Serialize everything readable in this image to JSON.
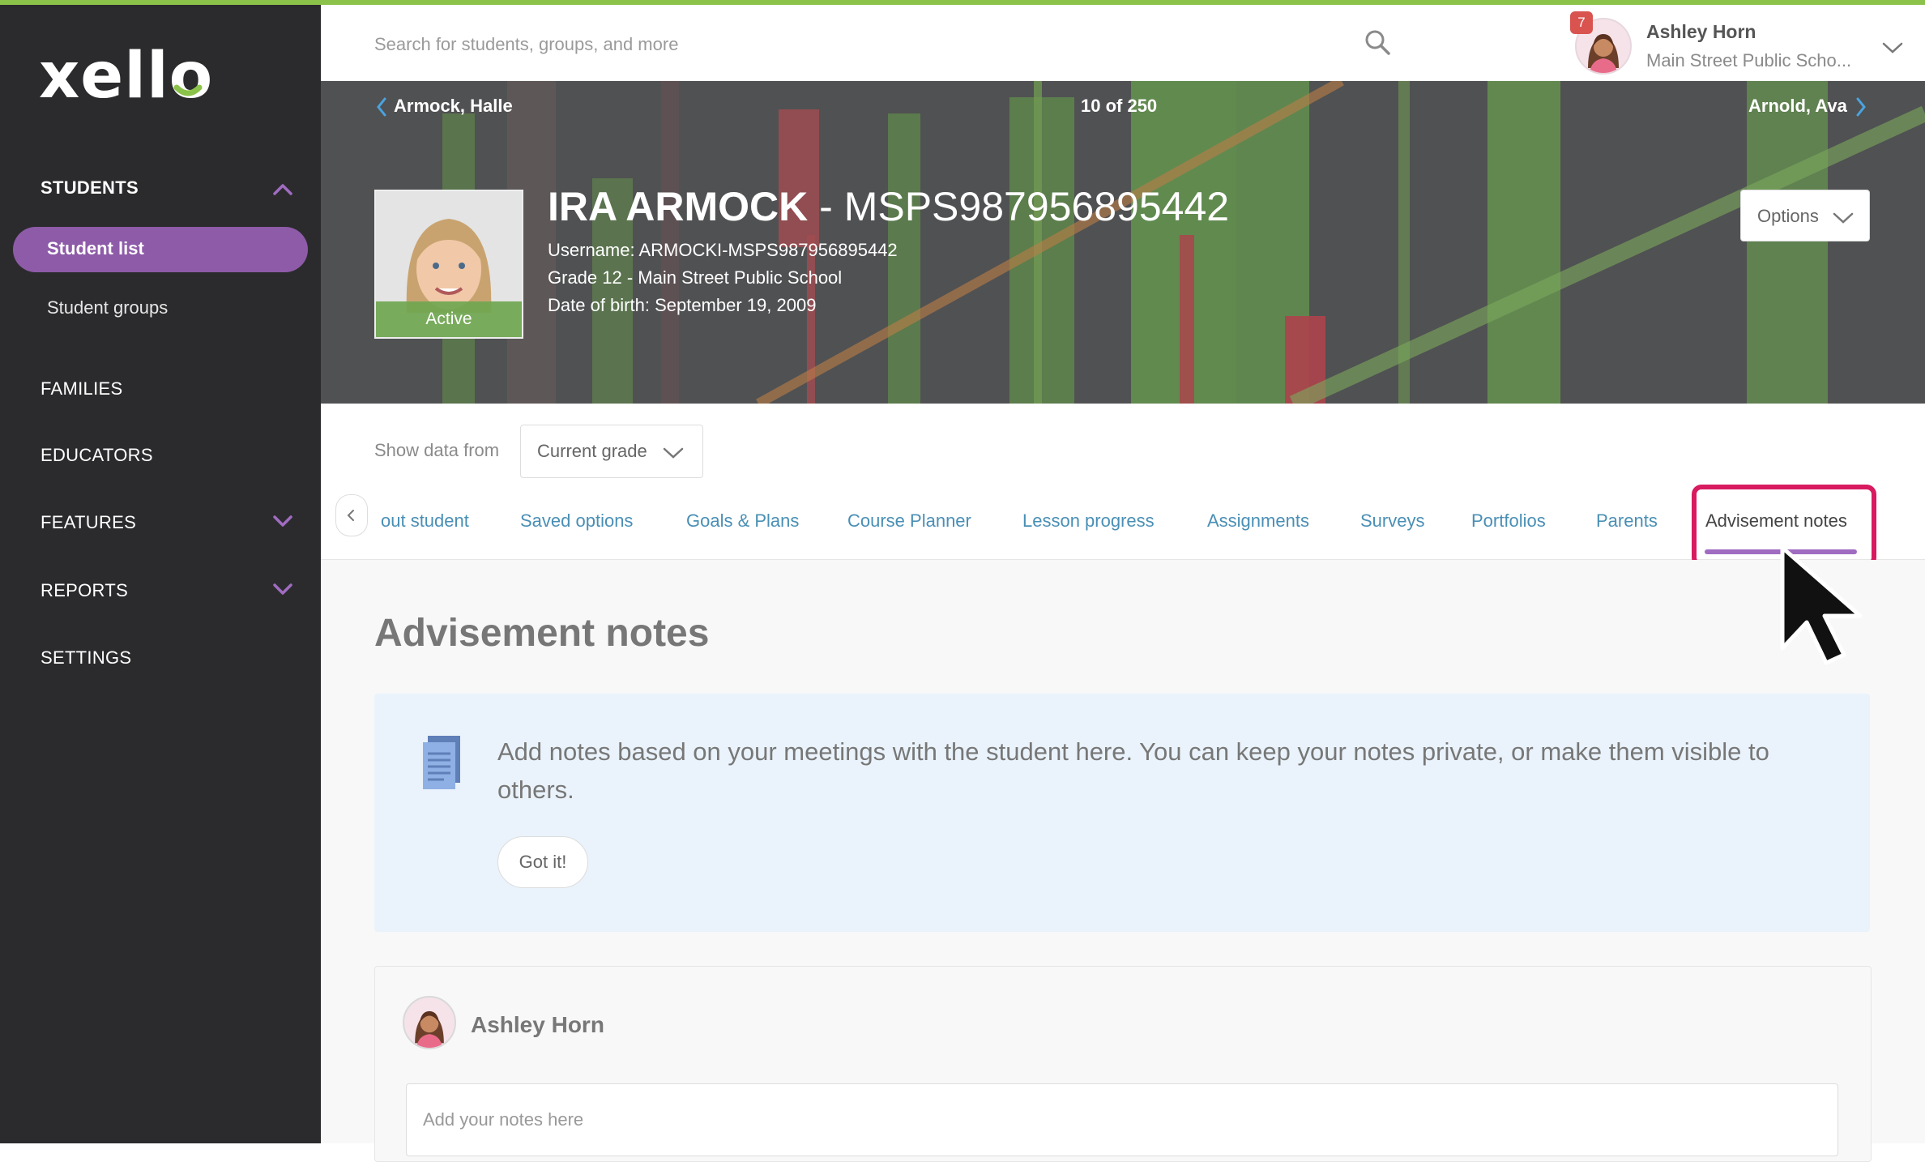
{
  "app": {
    "logo_text": "xello",
    "accent_color": "#8e5ba8",
    "top_border_color": "#8bc34a"
  },
  "sidebar": {
    "sections": [
      {
        "label": "STUDENTS",
        "expanded": true,
        "icon": "chevron-up-icon"
      },
      {
        "label": "FAMILIES"
      },
      {
        "label": "EDUCATORS"
      },
      {
        "label": "FEATURES",
        "icon": "chevron-down-icon"
      },
      {
        "label": "REPORTS",
        "icon": "chevron-down-icon"
      },
      {
        "label": "SETTINGS"
      }
    ],
    "student_items": [
      {
        "label": "Student list",
        "active": true
      },
      {
        "label": "Student groups"
      }
    ]
  },
  "topbar": {
    "search_placeholder": "Search for students, groups, and more",
    "notification_count": "7",
    "user_name": "Ashley Horn",
    "user_school": "Main Street Public Scho..."
  },
  "banner": {
    "prev_student": "Armock, Halle",
    "position": "10 of 250",
    "next_student": "Arnold, Ava",
    "student_name": "IRA ARMOCK",
    "student_separator": " - ",
    "student_id": "MSPS987956895442",
    "username_line": "Username: ARMOCKI-MSPS987956895442",
    "grade_line": "Grade 12 - Main Street Public School",
    "dob_line": "Date of birth: September 19, 2009",
    "status": "Active",
    "options_label": "Options"
  },
  "filter": {
    "label": "Show data from",
    "value": "Current grade"
  },
  "tabs": [
    {
      "label": "out student"
    },
    {
      "label": "Saved options"
    },
    {
      "label": "Goals & Plans"
    },
    {
      "label": "Course Planner"
    },
    {
      "label": "Lesson progress"
    },
    {
      "label": "Assignments"
    },
    {
      "label": "Surveys"
    },
    {
      "label": "Portfolios"
    },
    {
      "label": "Parents"
    },
    {
      "label": "Advisement notes",
      "active": true
    }
  ],
  "content": {
    "title": "Advisement notes",
    "info_text": "Add notes based on your meetings with the student here. You can keep your notes private, or make them visible to others.",
    "got_it_label": "Got it!",
    "note_author": "Ashley Horn",
    "note_placeholder": "Add your notes here"
  }
}
